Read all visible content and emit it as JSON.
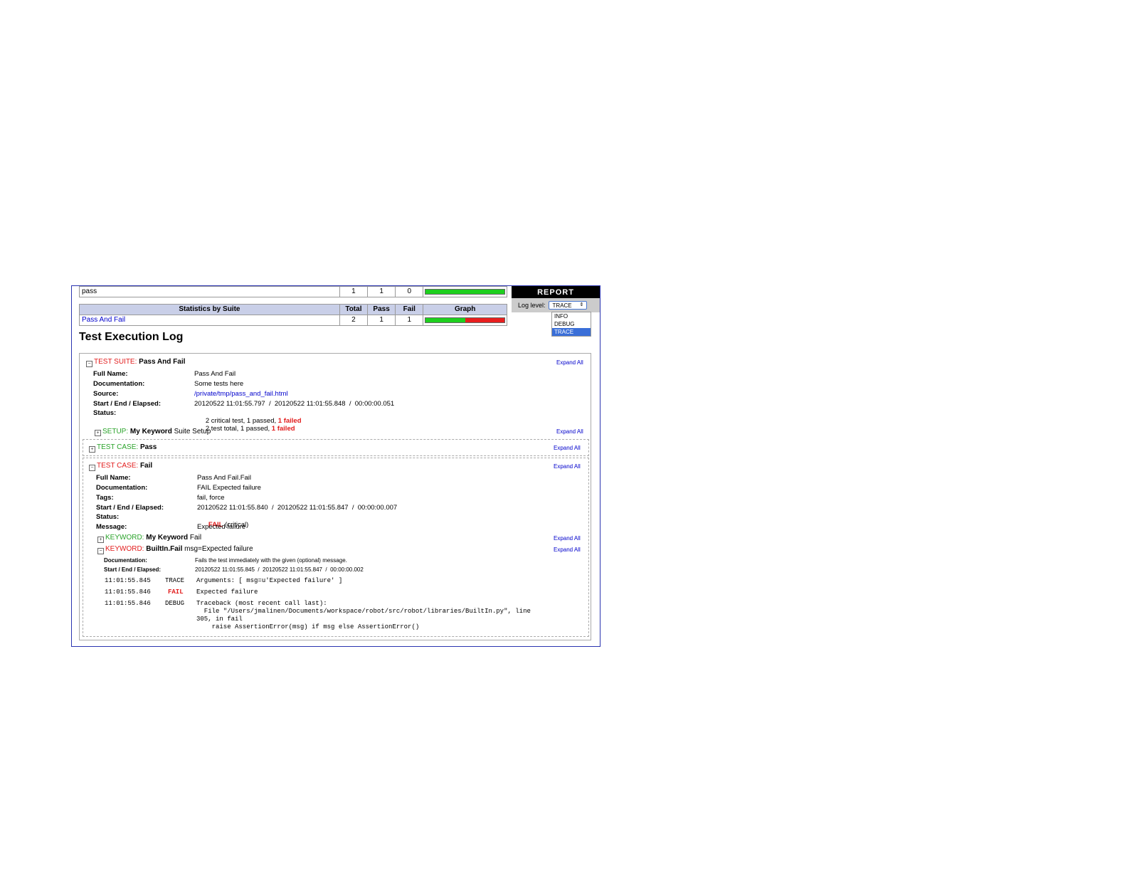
{
  "top_links": {
    "link1": "",
    "link2": "",
    "link3": "",
    "link4": "",
    "link5": "",
    "link6": ""
  },
  "stats": {
    "tag_row": {
      "name": "pass",
      "total": "1",
      "pass": "1",
      "fail": "0",
      "pass_fraction": 1.0
    },
    "suite_header": {
      "name": "Statistics by Suite",
      "total": "Total",
      "pass": "Pass",
      "fail": "Fail",
      "graph": "Graph"
    },
    "suite_row": {
      "name": "Pass And Fail",
      "total": "2",
      "pass": "1",
      "fail": "1",
      "pass_fraction": 0.5
    }
  },
  "report_banner": "REPORT",
  "log_level": {
    "label": "Log level:",
    "selected": "TRACE",
    "options": [
      "INFO",
      "DEBUG",
      "TRACE"
    ]
  },
  "log_title": "Test Execution Log",
  "expand_all": "Expand All",
  "suite": {
    "type_label": "TEST SUITE:",
    "name": "Pass And Fail",
    "meta": [
      {
        "label": "Full Name:",
        "value": "Pass And Fail"
      },
      {
        "label": "Documentation:",
        "value": "Some tests here"
      },
      {
        "label": "Source:",
        "value": "/private/tmp/pass_and_fail.html"
      },
      {
        "label": "Start / End / Elapsed:",
        "value": "20120522 11:01:55.797  /  20120522 11:01:55.848  /  00:00:00.051"
      },
      {
        "label": "Status:",
        "value": "2 critical test, 1 passed, ",
        "value_fail": "1 failed"
      }
    ],
    "status_line2": "2 test total, 1 passed, ",
    "status_line2_fail": "1 failed"
  },
  "setup": {
    "type_label": "SETUP:",
    "name": "My Keyword",
    "args": "Suite Setup"
  },
  "test_pass": {
    "type_label": "TEST CASE:",
    "name": "Pass"
  },
  "test_fail": {
    "type_label": "TEST CASE:",
    "name": "Fail",
    "meta": [
      {
        "label": "Full Name:",
        "value": "Pass And Fail.Fail"
      },
      {
        "label": "Documentation:",
        "value": "FAIL Expected failure"
      },
      {
        "label": "Tags:",
        "value": "fail, force"
      },
      {
        "label": "Start / End / Elapsed:",
        "value": "20120522 11:01:55.840  /  20120522 11:01:55.847  /  00:00:00.007"
      },
      {
        "label": "Status:",
        "value_fail": "FAIL",
        "value": " (critical)"
      },
      {
        "label": "Message:",
        "value": "Expected failure"
      }
    ]
  },
  "kw1": {
    "type_label": "KEYWORD:",
    "name": "My Keyword",
    "args": "Fail"
  },
  "kw2": {
    "type_label": "KEYWORD:",
    "name": "BuiltIn.Fail",
    "args": "msg=Expected failure",
    "meta": [
      {
        "label": "Documentation:",
        "value": "Fails the test immediately with the given (optional) message."
      },
      {
        "label": "Start / End / Elapsed:",
        "value": "20120522 11:01:55.845  /  20120522 11:01:55.847  /  00:00:00.002"
      }
    ],
    "messages": [
      {
        "time": "11:01:55.845",
        "level": "TRACE",
        "text": "Arguments: [ msg=u'Expected failure' ]"
      },
      {
        "time": "11:01:55.846",
        "level": "FAIL",
        "text": "Expected failure"
      },
      {
        "time": "11:01:55.846",
        "level": "DEBUG",
        "text": "Traceback (most recent call last):"
      }
    ],
    "traceback_lines": [
      "  File \"/Users/jmalinen/Documents/workspace/robot/src/robot/libraries/BuiltIn.py\", line",
      "305, in fail",
      "    raise AssertionError(msg) if msg else AssertionError()"
    ]
  }
}
